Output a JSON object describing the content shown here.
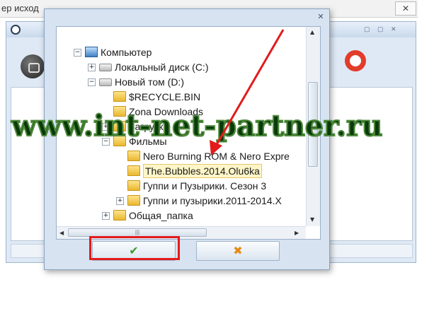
{
  "background_window": {
    "title_fragment": "ер исход",
    "close_glyph": "✕",
    "window_controls": "▢ ▢ ✕"
  },
  "dialog": {
    "close_glyph": "✕",
    "tree": [
      {
        "label": "Компьютер",
        "icon": "computer-icon",
        "expander": "−"
      },
      {
        "label": "Локальный диск (C:)",
        "icon": "drive-icon",
        "expander": "+"
      },
      {
        "label": "Новый том (D:)",
        "icon": "drive-icon",
        "expander": "−"
      },
      {
        "label": "$RECYCLE.BIN",
        "icon": "folder-icon",
        "expander": ""
      },
      {
        "label": "Zona Downloads",
        "icon": "folder-icon",
        "expander": ""
      },
      {
        "label": "Загрузки",
        "icon": "folder-icon",
        "expander": "+"
      },
      {
        "label": "Фильмы",
        "icon": "folder-icon",
        "expander": "−"
      },
      {
        "label": "Nero Burning ROM & Nero Expre",
        "icon": "folder-icon",
        "expander": ""
      },
      {
        "label": "The.Bubbles.2014.Olu6ka",
        "icon": "folder-icon",
        "expander": "",
        "selected": true
      },
      {
        "label": "Гуппи и Пузырики. Сезон 3",
        "icon": "folder-icon",
        "expander": ""
      },
      {
        "label": "Гуппи и пузырики.2011-2014.X",
        "icon": "folder-icon",
        "expander": "+"
      },
      {
        "label": "Общая_папка",
        "icon": "folder-icon",
        "expander": "+"
      }
    ],
    "scroll": {
      "up": "▲",
      "down": "▼",
      "left": "◀",
      "right": "▶",
      "grip": "|||"
    },
    "ok_button": {
      "glyph": "✔",
      "color": "#3d9a2b"
    },
    "cancel_button": {
      "glyph": "✖",
      "color": "#e58b12"
    }
  },
  "overlay": {
    "watermark": "www.int-net-partner.ru",
    "highlight_color": "#e31b1b",
    "arrow_color": "#e31b1b"
  }
}
